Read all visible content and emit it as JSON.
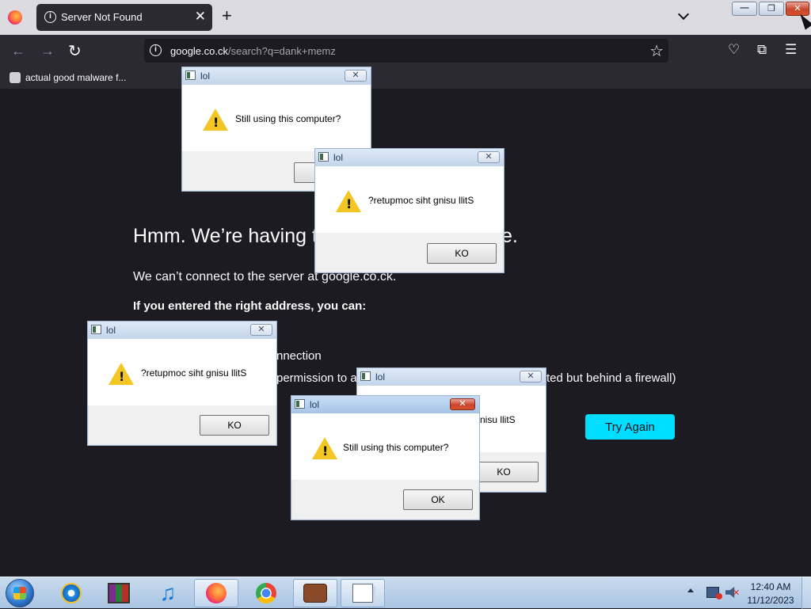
{
  "browser": {
    "tab_title": "Server Not Found",
    "tab_close": "✕",
    "new_tab": "+",
    "url_host": "google.co.ck",
    "url_rest": "/search?q=dank+memz",
    "bookmark_label": "actual good malware f..."
  },
  "window_buttons": {
    "minimize": "—",
    "restore": "❐",
    "close": "✕"
  },
  "error_page": {
    "title": "Hmm. We’re having t",
    "title_tail": "e.",
    "description": "We can’t connect to the server at google.co.ck.",
    "intro": "If you entered the right address, you can:",
    "fragment_connection": "nnection",
    "fragment_permission": "permission to a",
    "fragment_firewall": "ted but behind a firewall)",
    "try_again": "Try Again"
  },
  "dialogs": [
    {
      "title": "lol",
      "message": "Still using this computer?",
      "button": ""
    },
    {
      "title": "lol",
      "message": "?retupmoc siht gnisu llitS",
      "button": "KO"
    },
    {
      "title": "lol",
      "message": "?retupmoc siht gnisu llitS",
      "button": "KO"
    },
    {
      "title": "lol",
      "message": "nisu llitS",
      "button": "KO"
    },
    {
      "title": "lol",
      "message": "Still using this computer?",
      "button": "OK"
    }
  ],
  "taskbar": {
    "apps": [
      "internet-explorer",
      "winrar",
      "itunes",
      "firefox",
      "chrome",
      "dank-memz",
      "lol-dialog"
    ],
    "clock_time": "12:40 AM",
    "clock_date": "11/12/2023"
  },
  "colors": {
    "try_again_bg": "#00ddff",
    "page_bg": "#1c1b22",
    "toolbar_bg": "#2b2a33",
    "warning": "#f3c623"
  }
}
